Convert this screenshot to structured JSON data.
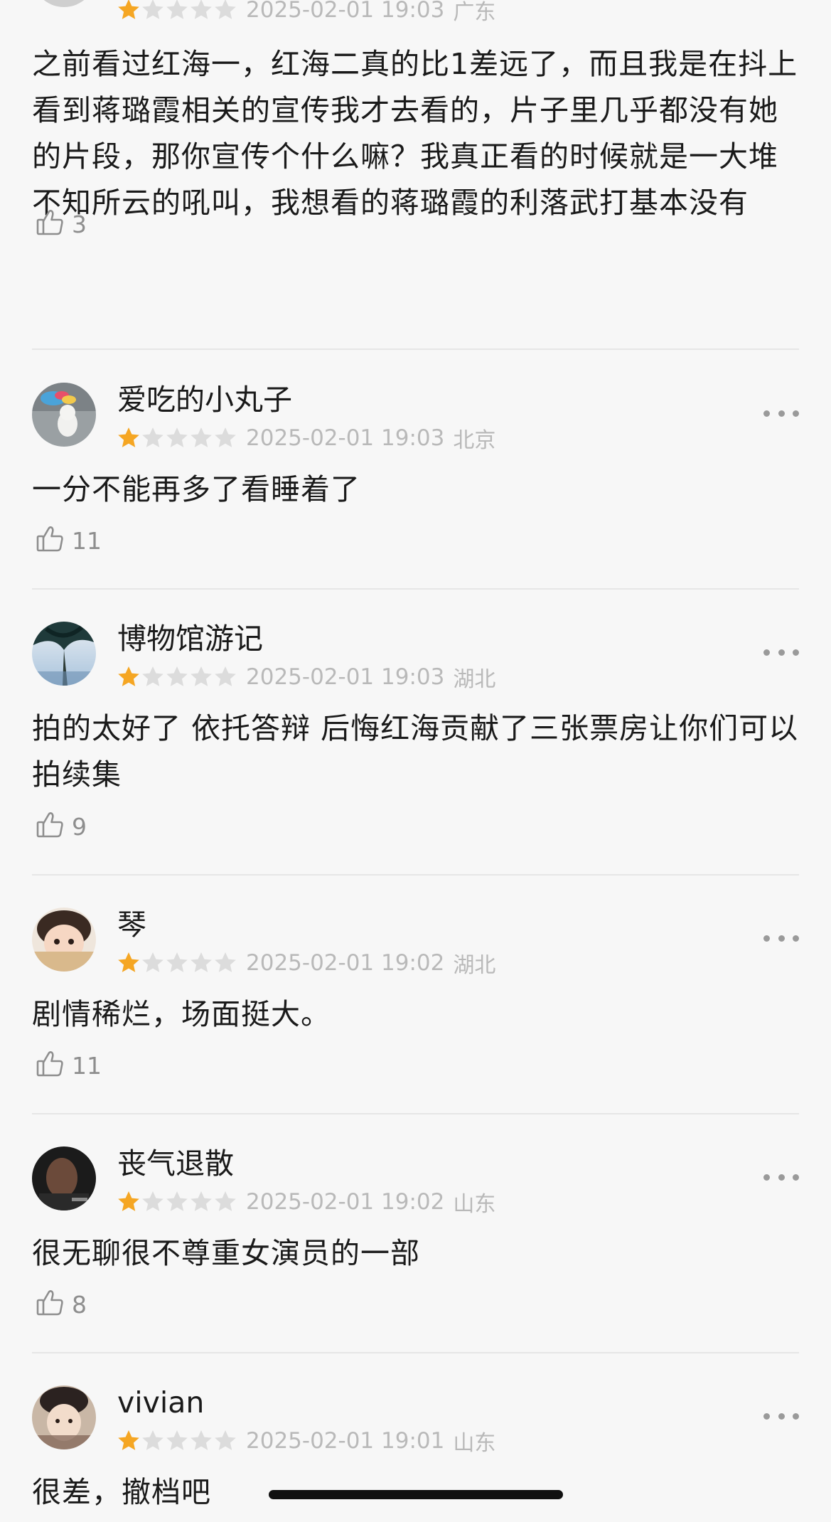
{
  "reviews": [
    {
      "username": "",
      "rating": 1,
      "max_rating": 5,
      "time": "2025-02-01 19:03",
      "region": "广东",
      "content": "之前看过红海一，红海二真的比1差远了，而且我是在抖上看到蒋璐霞相关的宣传我才去看的，片子里几乎都没有她的片段，那你宣传个什么嘛？我真正看的时候就是一大堆不知所云的吼叫，我想看的蒋璐霞的利落武打基本没有",
      "likes": "3"
    },
    {
      "username": "爱吃的小丸子",
      "rating": 1,
      "max_rating": 5,
      "time": "2025-02-01 19:03",
      "region": "北京",
      "content": "一分不能再多了看睡着了",
      "likes": "11"
    },
    {
      "username": "博物馆游记",
      "rating": 1,
      "max_rating": 5,
      "time": "2025-02-01 19:03",
      "region": "湖北",
      "content": "拍的太好了 依托答辩 后悔红海贡献了三张票房让你们可以拍续集",
      "likes": "9"
    },
    {
      "username": "琴",
      "rating": 1,
      "max_rating": 5,
      "time": "2025-02-01 19:02",
      "region": "湖北",
      "content": "剧情稀烂，场面挺大。",
      "likes": "11"
    },
    {
      "username": "丧气退散",
      "rating": 1,
      "max_rating": 5,
      "time": "2025-02-01 19:02",
      "region": "山东",
      "content": "很无聊很不尊重女演员的一部",
      "likes": "8"
    },
    {
      "username": "vivian",
      "rating": 1,
      "max_rating": 5,
      "time": "2025-02-01 19:01",
      "region": "山东",
      "content": "很差，撤档吧",
      "likes": ""
    }
  ],
  "icons": {
    "star": "star-icon",
    "like": "thumbs-up-icon",
    "more": "more-dots-icon"
  },
  "colors": {
    "background": "#f7f7f7",
    "star_filled": "#f5a623",
    "star_empty": "#dcdcdc",
    "meta_text": "#b9b9b9",
    "text": "#1a1a1a"
  }
}
